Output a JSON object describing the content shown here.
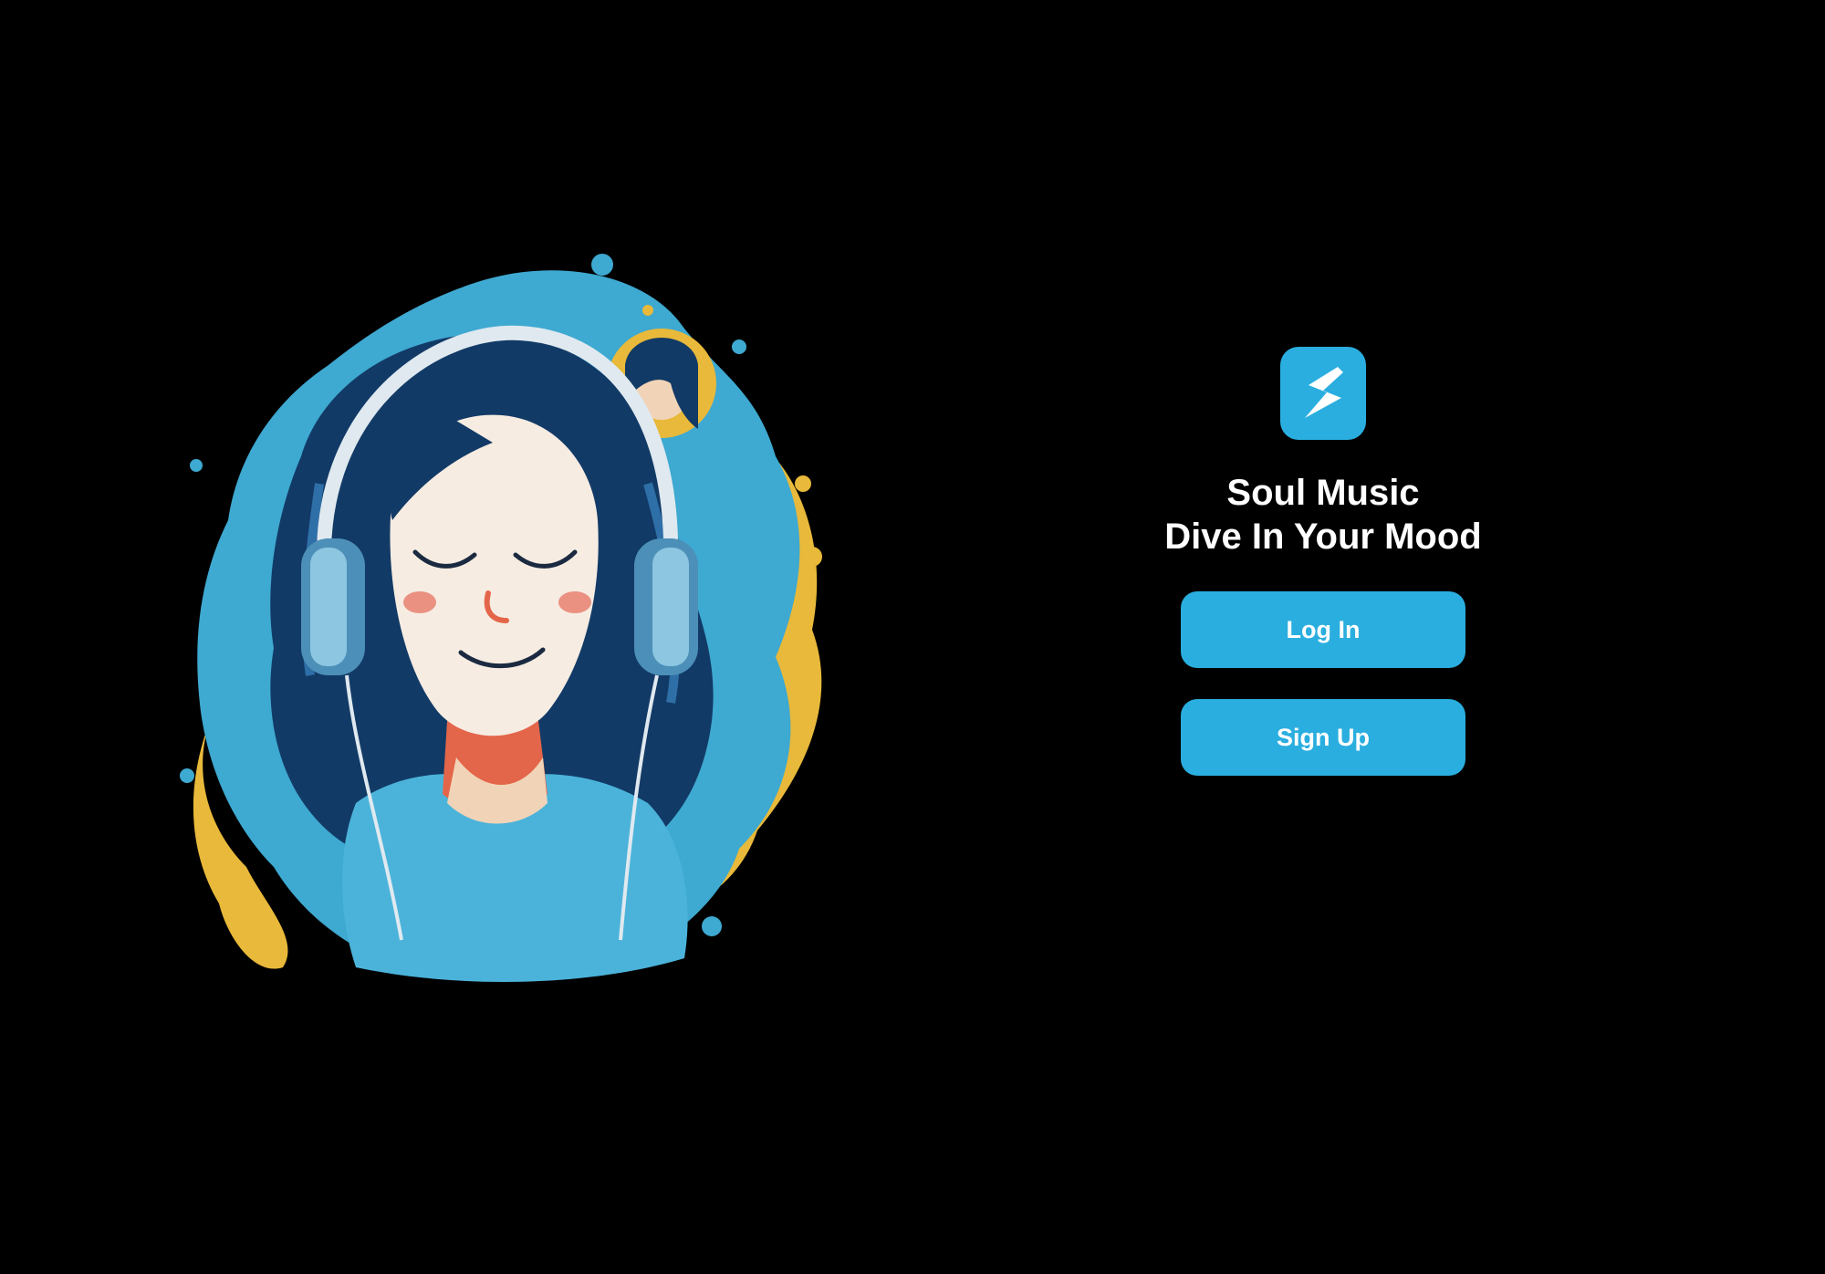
{
  "app": {
    "logo_icon": "lightning-s-logo-icon",
    "title": "Soul Music",
    "tagline": "Dive In Your Mood"
  },
  "hero": {
    "illustration": "girl-with-headphones-illustration"
  },
  "actions": {
    "login_label": "Log In",
    "signup_label": "Sign Up"
  },
  "colors": {
    "background": "#000000",
    "accent": "#2aaedf",
    "text": "#ffffff",
    "illustration_yellow": "#e8b93a",
    "illustration_blue": "#3ea9d1",
    "hair_navy": "#123a66"
  }
}
